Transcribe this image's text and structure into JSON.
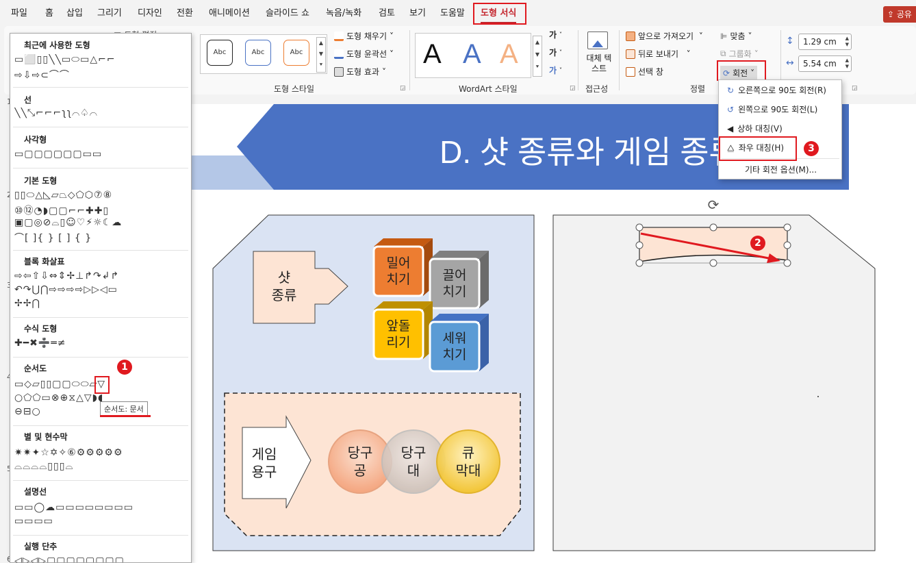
{
  "menu": {
    "tabs": [
      "파일",
      "홈",
      "삽입",
      "그리기",
      "디자인",
      "전환",
      "애니메이션",
      "슬라이드 쇼",
      "녹음/녹화",
      "검토",
      "보기",
      "도움말",
      "도형 서식"
    ],
    "share": "공유"
  },
  "ribbon": {
    "insert_shapes_hint": "도형 편집",
    "shape_styles": {
      "label": "도형 스타일",
      "preset_text": "Abc",
      "fill": "도형 채우기",
      "outline": "도형 윤곽선",
      "effects": "도형 효과"
    },
    "wordart": {
      "label": "WordArt 스타일",
      "letter": "A",
      "text_fill": "가",
      "text_outline": "가",
      "text_effects": "가"
    },
    "accessibility": {
      "label": "접근성",
      "alt_text": "대체 텍스트"
    },
    "arrange": {
      "label": "정렬",
      "bring_forward": "앞으로 가져오기",
      "send_backward": "뒤로 보내기",
      "selection_pane": "선택 창",
      "align": "맞춤",
      "group": "그룹화",
      "rotate": "회전"
    },
    "size": {
      "height": "1.29 cm",
      "width": "5.54 cm"
    }
  },
  "rotate_menu": {
    "items": [
      "오른쪽으로 90도 회전(R)",
      "왼쪽으로 90도 회전(L)",
      "상하 대칭(V)",
      "좌우 대칭(H)",
      "기타 회전 옵션(M)..."
    ]
  },
  "shapes_panel": {
    "categories": [
      "최근에 사용한 도형",
      "선",
      "사각형",
      "기본 도형",
      "블록 화살표",
      "수식 도형",
      "순서도",
      "별 및 현수막",
      "설명선",
      "실행 단추"
    ],
    "tooltip": "순서도: 문서"
  },
  "slide": {
    "title": "D. 샷 종류와 게임 종류",
    "shot_label": "샷\n종류",
    "cubes": [
      "밀어\n치기",
      "끌어\n치기",
      "앞돌\n리기",
      "세워\n치기"
    ],
    "gear_label": "게임\n용구",
    "circles": [
      "당구\n공",
      "당구\n대",
      "큐\n막대"
    ]
  },
  "row_numbers": [
    "1",
    "2",
    "3",
    "4",
    "5",
    "6"
  ],
  "badges": [
    "1",
    "2",
    "3"
  ],
  "colors": {
    "accent_red": "#e0191f",
    "title_blue": "#4a72c4",
    "title_band": "#b4c7e7",
    "peach": "#fde4d4",
    "left_panel": "#dae3f3",
    "right_panel": "#f2f2f2"
  }
}
